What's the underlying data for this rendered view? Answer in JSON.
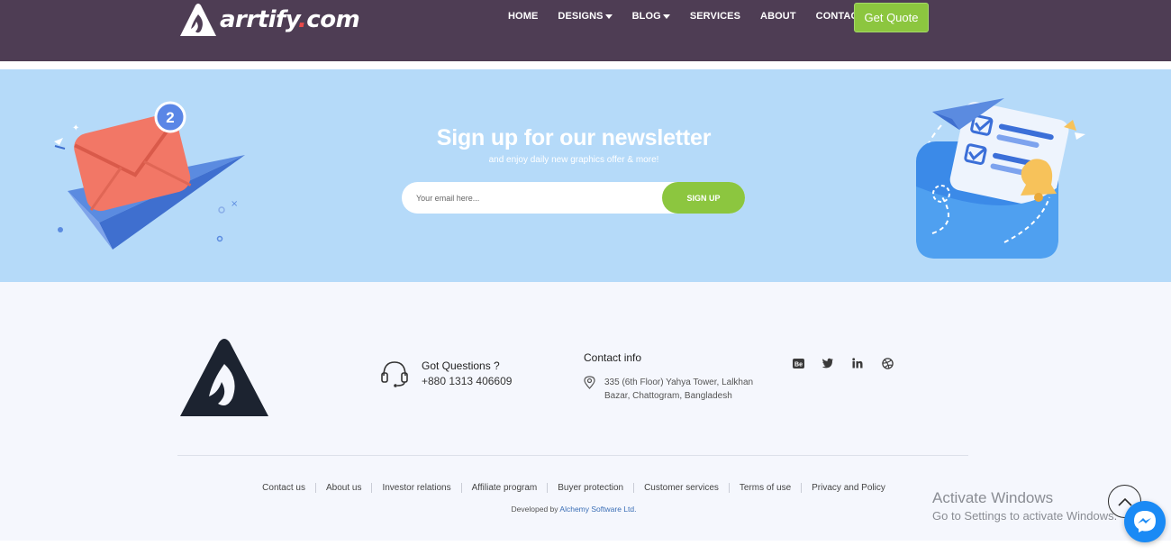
{
  "brand": {
    "logo_text": "arrtify",
    "logo_dot": ".",
    "logo_suffix": "com"
  },
  "nav": {
    "items": [
      {
        "label": "HOME",
        "has_caret": false
      },
      {
        "label": "DESIGNS",
        "has_caret": true
      },
      {
        "label": "BLOG",
        "has_caret": true
      },
      {
        "label": "SERVICES",
        "has_caret": false
      },
      {
        "label": "ABOUT",
        "has_caret": false
      },
      {
        "label": "CONTACT",
        "has_caret": false
      }
    ],
    "cta_label": "Get Quote"
  },
  "newsletter": {
    "title": "Sign up for our newsletter",
    "subtitle": "and enjoy daily new graphics offer & more!",
    "email_placeholder": "Your email here...",
    "button_label": "SIGN UP",
    "badge_count": "2"
  },
  "footer": {
    "questions_title": "Got Questions ?",
    "phone": "+880 1313 406609",
    "contact_title": "Contact info",
    "address": "335 (6th Floor) Yahya Tower, Lalkhan Bazar, Chattogram, Bangladesh",
    "social_icons": [
      "behance-icon",
      "twitter-icon",
      "linkedin-icon",
      "dribbble-icon"
    ],
    "links": [
      "Contact us",
      "About us",
      "Investor relations",
      "Affiliate program",
      "Buyer protection",
      "Customer services",
      "Terms of use",
      "Privacy and Policy"
    ],
    "developed_by_prefix": "Developed by",
    "developer_name": "Alchemy Software Ltd."
  },
  "overlay": {
    "activate_title": "Activate Windows",
    "activate_sub": "Go to Settings to activate Windows."
  },
  "colors": {
    "nav_bg": "#4e3d54",
    "accent_green": "#8cc63f",
    "newsletter_bg": "#b5daf9",
    "footer_bg": "#f5f7fd",
    "messenger_blue": "#1a8af5"
  }
}
